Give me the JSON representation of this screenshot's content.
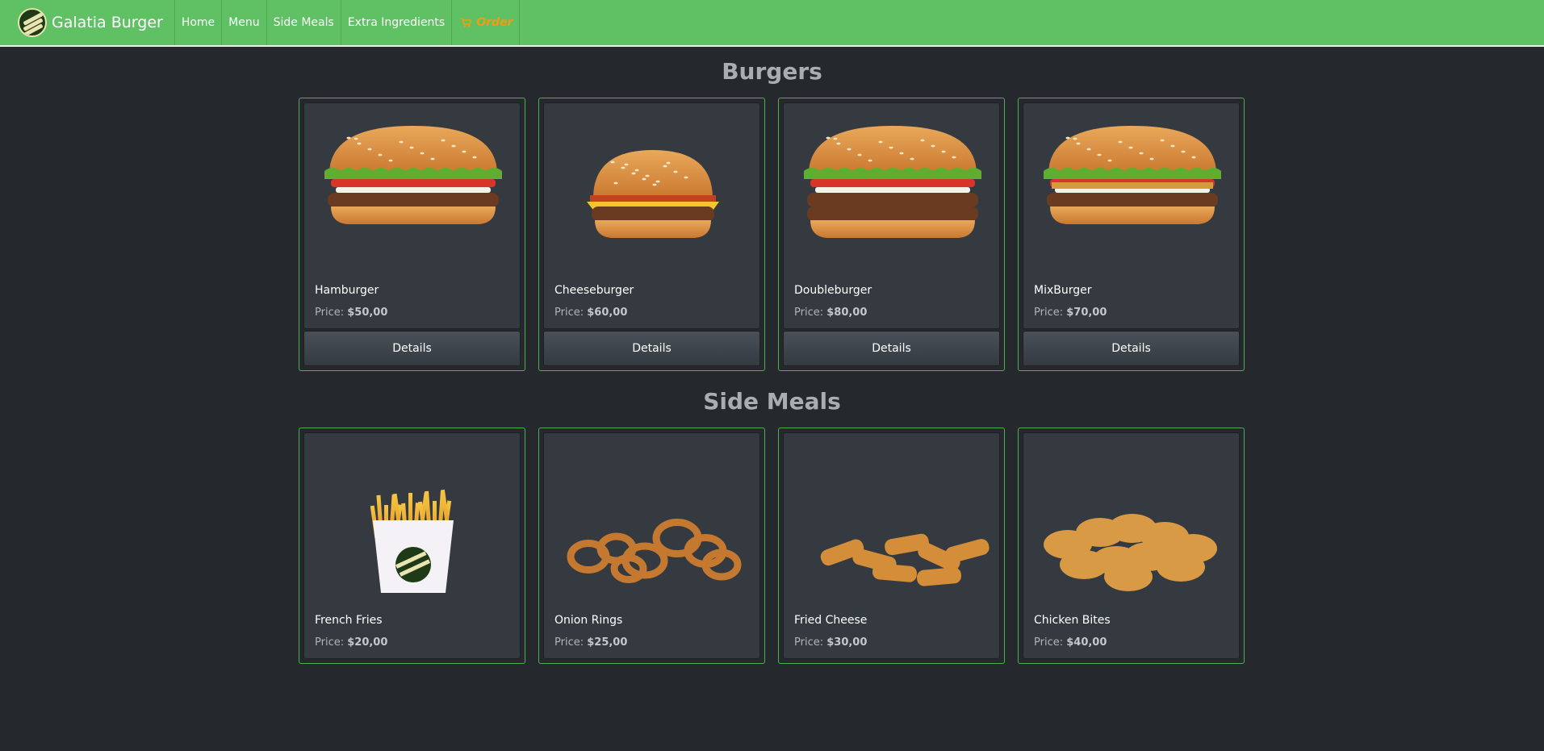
{
  "brand": {
    "name": "Galatia Burger"
  },
  "nav": {
    "items": [
      "Home",
      "Menu",
      "Side Meals",
      "Extra Ingredients"
    ],
    "order_label": "Order"
  },
  "sections": {
    "burgers_title": "Burgers",
    "sides_title": "Side Meals"
  },
  "price_prefix": "Price:",
  "burgers": [
    {
      "name": "Hamburger",
      "price": "$50,00",
      "button": "Details"
    },
    {
      "name": "Cheeseburger",
      "price": "$60,00",
      "button": "Details"
    },
    {
      "name": "Doubleburger",
      "price": "$80,00",
      "button": "Details"
    },
    {
      "name": "MixBurger",
      "price": "$70,00",
      "button": "Details"
    }
  ],
  "sides": [
    {
      "name": "French Fries",
      "price": "$20,00"
    },
    {
      "name": "Onion Rings",
      "price": "$25,00"
    },
    {
      "name": "Fried Cheese",
      "price": "$30,00"
    },
    {
      "name": "Chicken Bites",
      "price": "$40,00"
    }
  ],
  "colors": {
    "navbar": "#5fc164",
    "order": "#f39c12",
    "card_border": "#4caf50",
    "background": "#25282c"
  }
}
